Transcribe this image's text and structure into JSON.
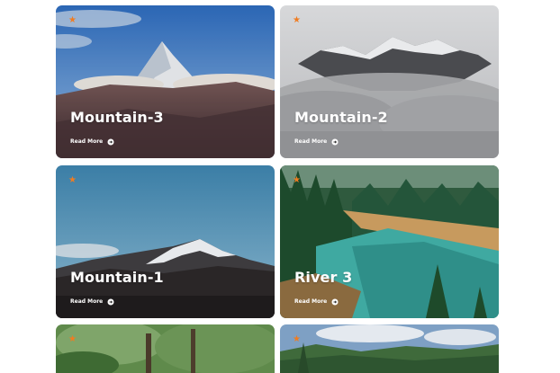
{
  "cards": [
    {
      "title": "Mountain-3",
      "read_more": "Read More",
      "icon": "star-icon"
    },
    {
      "title": "Mountain-2",
      "read_more": "Read More",
      "icon": "star-icon"
    },
    {
      "title": "Mountain-1",
      "read_more": "Read More",
      "icon": "star-icon"
    },
    {
      "title": "River 3",
      "read_more": "Read More",
      "icon": "star-icon"
    },
    {
      "title": "",
      "read_more": "",
      "icon": "star-icon"
    },
    {
      "title": "",
      "read_more": "",
      "icon": "star-icon"
    }
  ],
  "colors": {
    "accent": "#f07c21",
    "text": "#ffffff"
  }
}
